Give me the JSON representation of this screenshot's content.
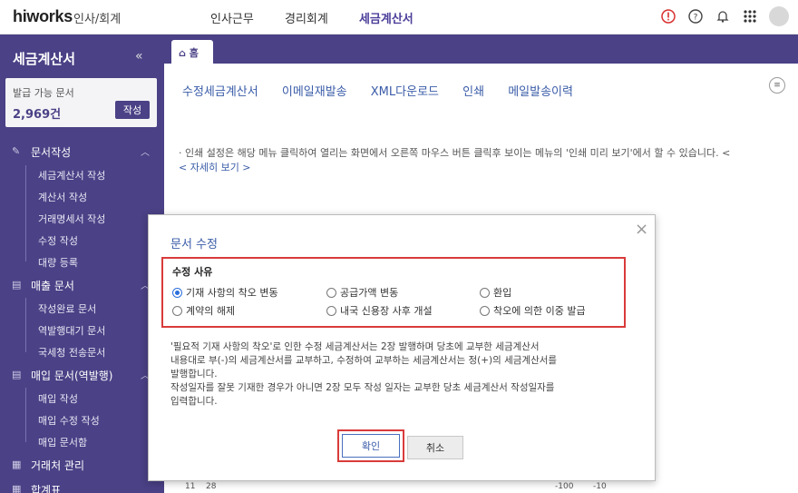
{
  "brand": {
    "logo": "hiworks",
    "module": "인사/회계"
  },
  "topnav": [
    {
      "label": "인사근무",
      "active": false
    },
    {
      "label": "경리회계",
      "active": false
    },
    {
      "label": "세금계산서",
      "active": true
    }
  ],
  "top_icons": [
    "alert-icon",
    "help-icon",
    "bell-icon",
    "apps-grid-icon",
    "avatar"
  ],
  "sidebar": {
    "title": "세금계산서",
    "collapse": "«",
    "quota": {
      "label": "발급 가능 문서",
      "count": "2,969건",
      "button": "작성"
    },
    "sections": [
      {
        "label": "문서작성",
        "icon": "✎",
        "items": [
          "세금계산서 작성",
          "계산서 작성",
          "거래명세서 작성",
          "수정 작성",
          "대량 등록"
        ]
      },
      {
        "label": "매출 문서",
        "icon": "▤",
        "items": [
          "작성완료 문서",
          "역발행대기 문서",
          "국세청 전송문서"
        ]
      },
      {
        "label": "매입 문서(역발행)",
        "icon": "▤",
        "items": [
          "매입 작성",
          "매입 수정 작성",
          "매입 문서함"
        ]
      },
      {
        "label": "거래처 관리",
        "icon": "▦",
        "items": []
      },
      {
        "label": "합계표",
        "icon": "▦",
        "items": []
      }
    ]
  },
  "tabs": {
    "home": "홈"
  },
  "actions": [
    "수정세금계산서",
    "이메일재발송",
    "XML다운로드",
    "인쇄",
    "메일발송이력"
  ],
  "notice": {
    "text": "· 인쇄 설정은 해당 메뉴 클릭하여 열리는 화면에서 오른쪽 마우스 버튼 클릭후 보이는 메뉴의 '인쇄 미리 보기'에서 할 수 있습니다. <",
    "link": "< 자세히 보기 >"
  },
  "background_row": [
    "11",
    "28",
    "-100",
    "-10"
  ],
  "modal": {
    "title": "문서 수정",
    "close": "×",
    "reason_title": "수정 사유",
    "options": [
      {
        "label": "기재 사항의 착오 변동",
        "selected": true
      },
      {
        "label": "공급가액 변동",
        "selected": false
      },
      {
        "label": "환입",
        "selected": false
      },
      {
        "label": "계약의 해제",
        "selected": false
      },
      {
        "label": "내국 신용장 사후 개설",
        "selected": false
      },
      {
        "label": "착오에 의한 이중 발급",
        "selected": false
      }
    ],
    "description": [
      "'필요적 기재 사항의 착오'로 인한 수정 세금계산서는 2장 발행하며 당초에 교부한 세금계산서",
      "내용대로 부(-)의 세금계산서를 교부하고, 수정하여 교부하는 세금계산서는 정(+)의 세금계산서를",
      "발행합니다.",
      "작성일자를 잘못 기재한 경우가 아니면 2장 모두 작성 일자는 교부한 당초 세금계산서 작성일자를",
      "입력합니다."
    ],
    "confirm": "확인",
    "cancel": "취소"
  },
  "colors": {
    "brand": "#4a4186",
    "link": "#3a5ca8",
    "highlight": "#d93b3b",
    "alert": "#d9302f"
  }
}
